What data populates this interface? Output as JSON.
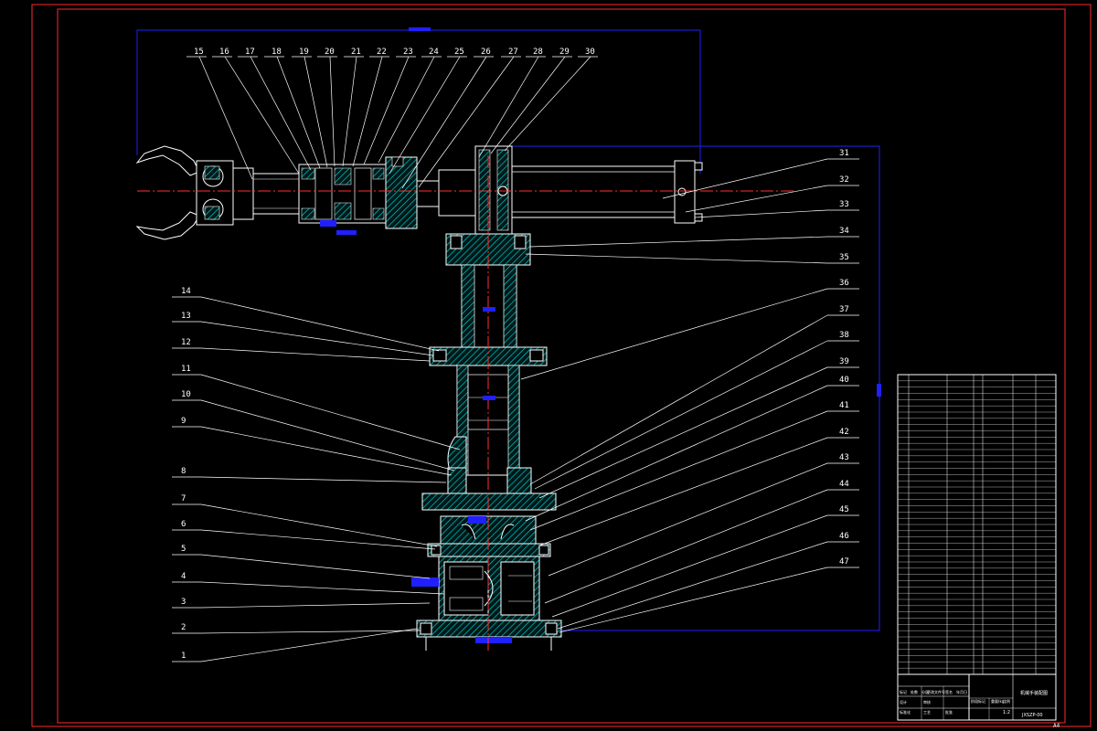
{
  "drawing": {
    "colors": {
      "background": "#000000",
      "border": "#ff2a2a",
      "outline": "#ffffff",
      "hatch": "#00c8c8",
      "centerline": "#ff3030",
      "dimension": "#2020ff",
      "leader": "#ffffff"
    },
    "top_callouts": [
      "15",
      "16",
      "17",
      "18",
      "19",
      "20",
      "21",
      "22",
      "23",
      "24",
      "25",
      "26",
      "27",
      "28",
      "29",
      "30"
    ],
    "left_callouts": [
      "14",
      "13",
      "12",
      "11",
      "10",
      "9",
      "8",
      "7",
      "6",
      "5",
      "4",
      "3",
      "2",
      "1"
    ],
    "right_callouts": [
      "31",
      "32",
      "33",
      "34",
      "35",
      "36",
      "37",
      "38",
      "39",
      "40",
      "41",
      "42",
      "43",
      "44",
      "45",
      "46",
      "47"
    ],
    "sheet_mark": "A4",
    "title_block": {
      "label_cells": [
        "标记",
        "处数",
        "分区",
        "更改文件号",
        "签名",
        "年月日",
        "设计",
        "标准化",
        "审核",
        "工艺",
        "批准"
      ],
      "stage_labels": [
        "阶段标记",
        "重量(kg)",
        "比例"
      ],
      "scale_value": "1:2",
      "drawing_title": "机械手装配图",
      "drawing_number": "JXSZP-00"
    }
  }
}
